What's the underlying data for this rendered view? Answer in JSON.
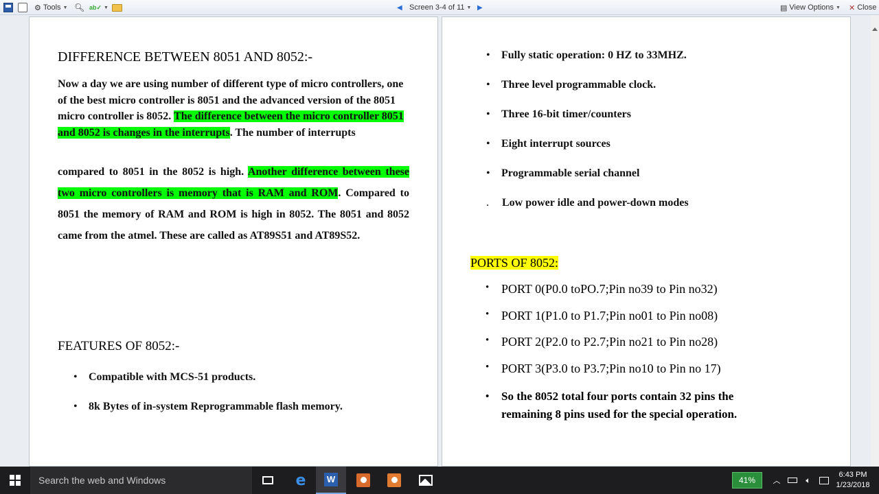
{
  "toolbar": {
    "tools_label": "Tools",
    "screen_label": "Screen 3-4 of 11",
    "view_options_label": "View Options",
    "close_label": "Close"
  },
  "left_page": {
    "heading": "DIFFERENCE BETWEEN 8051 AND 8052:-",
    "para1_plain": "Now a day we are using number of different type of micro controllers, one of the best micro controller is 8051 and the advanced version of the 8051 micro controller is 8052. ",
    "para1_highlight": "The difference between the micro controller 8051 and 8052 is changes in the interrupts",
    "para1_tail": ". The number of interrupts",
    "para2_plain": "compared to 8051 in the 8052 is high. ",
    "para2_highlight": "Another difference between these two micro controllers is memory that is RAM and ROM",
    "para2_tail": ". Compared to 8051 the memory of RAM and ROM is high in 8052. The 8051 and 8052 came from the atmel.  These are called as AT89S51 and AT89S52.",
    "features_heading": "FEATURES OF 8052:-",
    "features": [
      "Compatible with MCS-51 products.",
      "8k Bytes of in-system Reprogrammable flash memory."
    ]
  },
  "right_page": {
    "features": [
      "Fully static operation: 0 HZ to 33MHZ.",
      "Three level programmable clock.",
      "Three 16-bit timer/counters",
      "Eight interrupt sources",
      "Programmable serial channel",
      "Low power idle and power-down modes"
    ],
    "ports_heading": "PORTS OF 8052:",
    "ports": [
      "PORT 0(P0.0 toPO.7;Pin no39 to Pin no32)",
      "PORT 1(P1.0 to P1.7;Pin no01 to Pin no08)",
      "PORT 2(P2.0 to P2.7;Pin no21 to Pin no28)",
      "PORT 3(P3.0 to P3.7;Pin no10 to Pin no 17)"
    ],
    "summary_line1": "So the 8052 total four ports contain 32 pins the",
    "summary_line2": "remaining 8 pins used for the special operation."
  },
  "taskbar": {
    "search_placeholder": "Search the web and Windows",
    "battery": "41%",
    "time": "6:43 PM",
    "date": "1/23/2018"
  },
  "colors": {
    "highlight_green": "#00ff00",
    "highlight_yellow": "#ffff00",
    "taskbar": "#1d1d1f"
  }
}
